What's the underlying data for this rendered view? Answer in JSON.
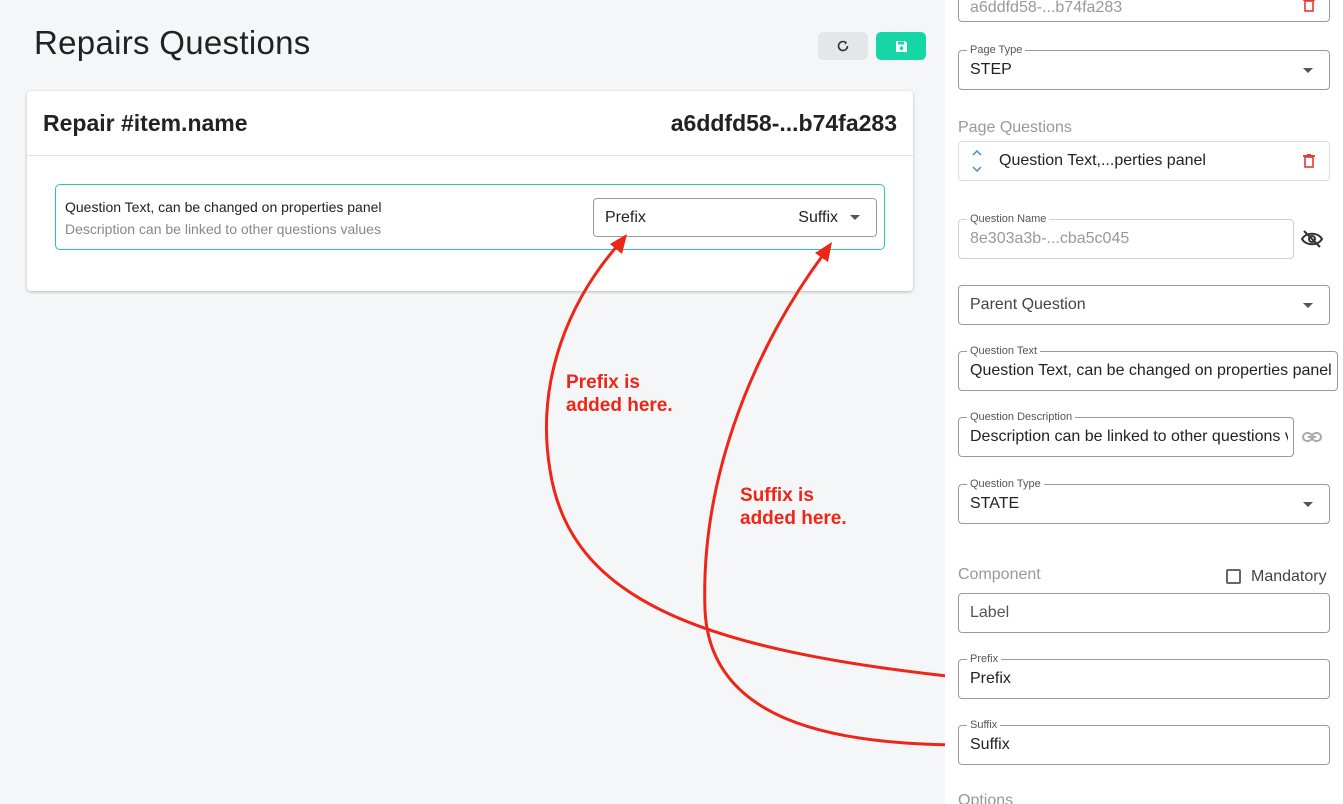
{
  "header": {
    "title": "Repairs Questions",
    "refresh_icon": "refresh-icon",
    "save_icon": "save-icon"
  },
  "card": {
    "title": "Repair #item.name",
    "id": "a6ddfd58-...b74fa283",
    "question": {
      "text": "Question Text, can be changed on properties panel",
      "description": "Description can be linked to other questions values",
      "prefix": "Prefix",
      "suffix": "Suffix"
    }
  },
  "annotations": {
    "prefix_line1": "Prefix is",
    "prefix_line2": "added here.",
    "suffix_line1": "Suffix is",
    "suffix_line2": "added here.",
    "color": "#ee2617"
  },
  "panel": {
    "page_id": "a6ddfd58-...b74fa283",
    "page_type_label": "Page Type",
    "page_type_value": "STEP",
    "page_questions_label": "Page Questions",
    "page_question_item": "Question Text,...perties panel",
    "question_name_label": "Question Name",
    "question_name_value": "8e303a3b-...cba5c045",
    "parent_question_value": "Parent Question",
    "question_text_label": "Question Text",
    "question_text_value": "Question Text, can be changed on properties panel",
    "question_description_label": "Question Description",
    "question_description_value": "Description can be linked to other questions values",
    "question_type_label": "Question Type",
    "question_type_value": "STATE",
    "component_label": "Component",
    "mandatory_label": "Mandatory",
    "label_placeholder": "Label",
    "prefix_label": "Prefix",
    "prefix_value": "Prefix",
    "suffix_label": "Suffix",
    "suffix_value": "Suffix",
    "options_label": "Options"
  },
  "colors": {
    "accent": "#17d6a6",
    "question_border": "#27c9a8",
    "delete": "#e53935"
  }
}
